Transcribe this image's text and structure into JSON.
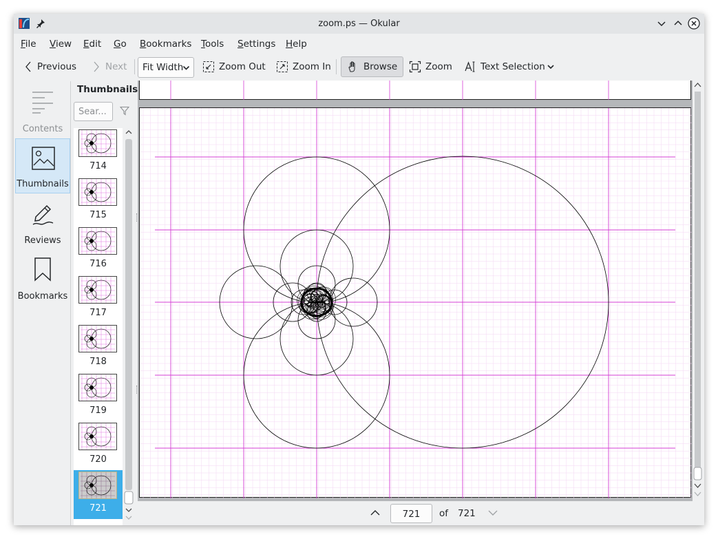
{
  "window": {
    "title": "zoom.ps — Okular"
  },
  "menubar": [
    {
      "pre": "",
      "ul": "F",
      "post": "ile"
    },
    {
      "pre": "",
      "ul": "V",
      "post": "iew"
    },
    {
      "pre": "",
      "ul": "E",
      "post": "dit"
    },
    {
      "pre": "",
      "ul": "G",
      "post": "o"
    },
    {
      "pre": "",
      "ul": "B",
      "post": "ookmarks"
    },
    {
      "pre": "",
      "ul": "T",
      "post": "ools"
    },
    {
      "pre": "",
      "ul": "S",
      "post": "ettings"
    },
    {
      "pre": "",
      "ul": "H",
      "post": "elp"
    }
  ],
  "toolbar": {
    "previous": "Previous",
    "next": "Next",
    "zoom_mode": "Fit Width",
    "zoom_out": "Zoom Out",
    "zoom_in": "Zoom In",
    "browse": "Browse",
    "zoom": "Zoom",
    "text_selection": "Text Selection"
  },
  "sidebar": {
    "tabs": [
      {
        "label": "Contents",
        "icon": "contents-icon",
        "active": false,
        "enabled": false
      },
      {
        "label": "Thumbnails",
        "icon": "thumbnails-icon",
        "active": true,
        "enabled": true
      },
      {
        "label": "Reviews",
        "icon": "reviews-icon",
        "active": false,
        "enabled": true
      },
      {
        "label": "Bookmarks",
        "icon": "bookmarks-icon",
        "active": false,
        "enabled": true
      }
    ]
  },
  "thumbnails": {
    "header": "Thumbnails",
    "search_placeholder": "Sear...",
    "pages": [
      "714",
      "715",
      "716",
      "717",
      "718",
      "719",
      "720",
      "721"
    ],
    "selected": "721"
  },
  "pager": {
    "current": "721",
    "of": "of",
    "total": "721"
  },
  "colors": {
    "accent": "#3daee9",
    "grid_major": "#d43fd4",
    "grid_minor": "#f3d6f3",
    "curve": "#000000"
  }
}
